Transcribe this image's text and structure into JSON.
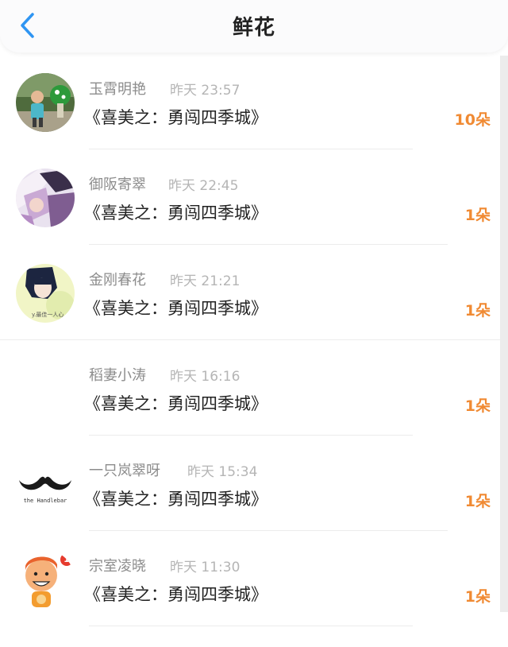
{
  "header": {
    "title": "鲜花",
    "back_icon": "chevron-left-icon",
    "accent_color": "#2f95f2"
  },
  "flower_color": "#f08a33",
  "entries": [
    {
      "name": "玉霄明艳",
      "time": "昨天 23:57",
      "work": "《喜美之：勇闯四季城》",
      "count": "10朵",
      "avatar": "photo-boy-avatar"
    },
    {
      "name": "御阪寄翠",
      "time": "昨天 22:45",
      "work": "《喜美之：勇闯四季城》",
      "count": "1朵",
      "avatar": "anime-couple-avatar"
    },
    {
      "name": "金刚春花",
      "time": "昨天 21:21",
      "work": "《喜美之：勇闯四季城》",
      "count": "1朵",
      "avatar": "anime-girl-avatar"
    },
    {
      "name": "稻妻小涛",
      "time": "昨天 16:16",
      "work": "《喜美之：勇闯四季城》",
      "count": "1朵",
      "avatar": "blank-avatar"
    },
    {
      "name": "一只岚翠呀",
      "time": "昨天 15:34",
      "work": "《喜美之：勇闯四季城》",
      "count": "1朵",
      "avatar": "mustache-avatar",
      "avatar_caption": "the Handlebar"
    },
    {
      "name": "宗室凌晓",
      "time": "昨天 11:30",
      "work": "《喜美之：勇闯四季城》",
      "count": "1朵",
      "avatar": "cartoon-kid-avatar",
      "avatar_badge": "1"
    }
  ]
}
